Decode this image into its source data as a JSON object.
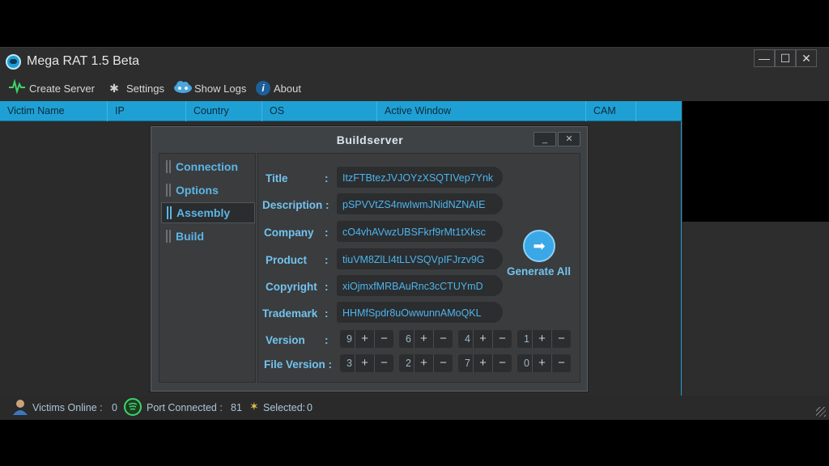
{
  "window": {
    "title": "Mega RAT 1.5 Beta",
    "minimize_glyph": "—",
    "maximize_glyph": "☐",
    "close_glyph": "✕"
  },
  "toolbar": {
    "create_server": "Create Server",
    "settings": "Settings",
    "show_logs": "Show Logs",
    "about": "About"
  },
  "grid": {
    "columns": [
      "Victim Name",
      "IP",
      "Country",
      "OS",
      "Active Window",
      "CAM"
    ]
  },
  "dialog": {
    "title": "Buildserver",
    "minimize_glyph": "_",
    "close_glyph": "✕",
    "nav": [
      "Connection",
      "Options",
      "Assembly",
      "Build"
    ],
    "active_nav": "Assembly",
    "fields": [
      {
        "label": "Title",
        "value": "ItzFTBtezJVJOYzXSQTIVep7Ynk"
      },
      {
        "label": "Description :",
        "value": "pSPVVtZS4nwIwmJNidNZNAIE"
      },
      {
        "label": "Company",
        "value": "cO4vhAVwzUBSFkrf9rMt1tXksc"
      },
      {
        "label": "Product",
        "value": "tiuVM8ZlLI4tLLVSQVpIFJrzv9G"
      },
      {
        "label": "Copyright",
        "value": "xiOjmxfMRBAuRnc3cCTUYmD"
      },
      {
        "label": "Trademark",
        "value": "HHMfSpdr8uOwwunnAMoQKL"
      }
    ],
    "generate_label": "Generate All",
    "version_label": "Version",
    "file_version_label": "File Version :",
    "version": [
      "9",
      "6",
      "4",
      "1"
    ],
    "file_version": [
      "3",
      "2",
      "7",
      "0"
    ],
    "plus": "+",
    "minus": "−"
  },
  "status": {
    "victims_label": "Victims Online :",
    "victims_value": "0",
    "port_label": "Port Connected :",
    "port_value": "81",
    "selected_label": "Selected:",
    "selected_value": "0"
  }
}
